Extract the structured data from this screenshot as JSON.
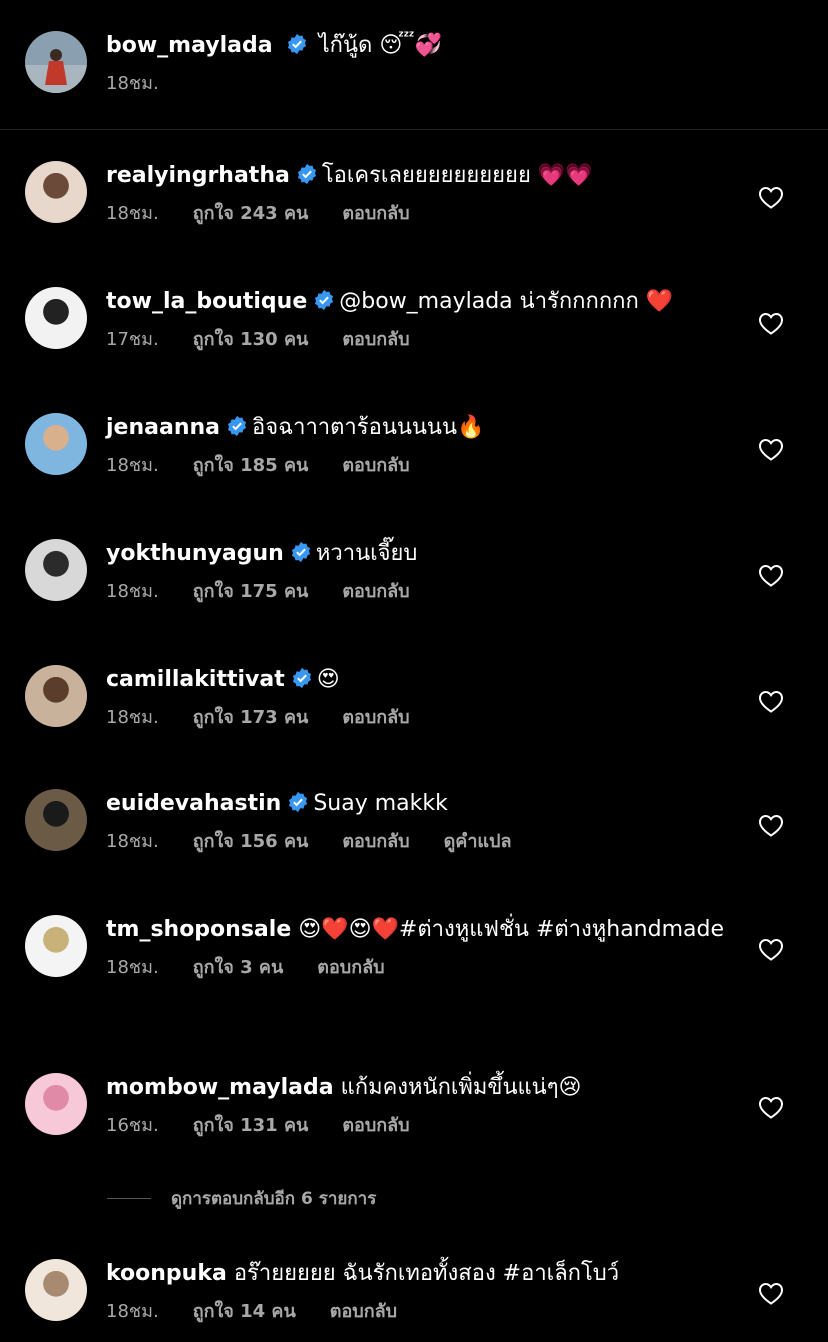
{
  "caption": {
    "username": "bow_maylada",
    "text": "ไก๊นู้ด 😴💞",
    "time": "18ชม.",
    "avatar_colors": [
      "#8a9fb0",
      "#c0392b"
    ]
  },
  "labels": {
    "reply": "ตอบกลับ",
    "translate": "ดูคำแปล"
  },
  "comments": [
    {
      "username": "realyingrhatha",
      "verified": true,
      "text": "โอเครเลยยยยยยยยยย 💗💗",
      "time": "18ชม.",
      "likes": "ถูกใจ 243 คน",
      "avatar_colors": [
        "#e8d8cc",
        "#6b4a3a"
      ]
    },
    {
      "username": "tow_la_boutique",
      "verified": true,
      "text": "@bow_maylada น่ารักกกกกก ❤️",
      "time": "17ชม.",
      "likes": "ถูกใจ 130 คน",
      "avatar_colors": [
        "#f2f2f2",
        "#222222"
      ]
    },
    {
      "username": "jenaanna",
      "verified": true,
      "text": "อิจฉาาาตาร้อนนนนน🔥",
      "time": "18ชม.",
      "likes": "ถูกใจ 185 คน",
      "avatar_colors": [
        "#7fb6e0",
        "#d9b08c"
      ]
    },
    {
      "username": "yokthunyagun",
      "verified": true,
      "text": "หวานเจี๊ยบ",
      "time": "18ชม.",
      "likes": "ถูกใจ 175 คน",
      "avatar_colors": [
        "#d8d8d8",
        "#2b2b2b"
      ]
    },
    {
      "username": "camillakittivat",
      "verified": true,
      "text": "😍",
      "time": "18ชม.",
      "likes": "ถูกใจ 173 คน",
      "avatar_colors": [
        "#c9b29b",
        "#5a3e2b"
      ]
    },
    {
      "username": "euidevahastin",
      "verified": true,
      "text": "Suay makkk",
      "time": "18ชม.",
      "likes": "ถูกใจ 156 คน",
      "translate": true,
      "avatar_colors": [
        "#6b5a45",
        "#1a1a1a"
      ]
    },
    {
      "username": "tm_shoponsale",
      "verified": false,
      "text": "😍❤️😍❤️#ต่างหูแฟชั่น #ต่างหูhandmade",
      "time": "18ชม.",
      "likes": "ถูกใจ 3 คน",
      "avatar_colors": [
        "#f4f4f4",
        "#c8b27a"
      ]
    },
    {
      "username": "mombow_maylada",
      "verified": false,
      "text": "แก้มคงหนักเพิ่มขึ้นแน่ๆ😢",
      "time": "16ชม.",
      "likes": "ถูกใจ 131 คน",
      "avatar_colors": [
        "#f6c8d8",
        "#e08aa8"
      ]
    },
    {
      "username": "koonpuka",
      "verified": false,
      "text": "อร๊ายยยยย ฉันรักเทอทั้งสอง #อาเล็กโบว์",
      "time": "18ชม.",
      "likes": "ถูกใจ 14 คน",
      "avatar_colors": [
        "#f0e6dc",
        "#a88a70"
      ]
    }
  ],
  "view_replies": "ดูการตอบกลับอีก 6 รายการ",
  "colors": {
    "verified": "#3897f0",
    "meta": "#a8a8a8",
    "divider": "#262626"
  },
  "icons": {
    "verified": "verified-badge-icon",
    "like": "heart-outline-icon"
  }
}
